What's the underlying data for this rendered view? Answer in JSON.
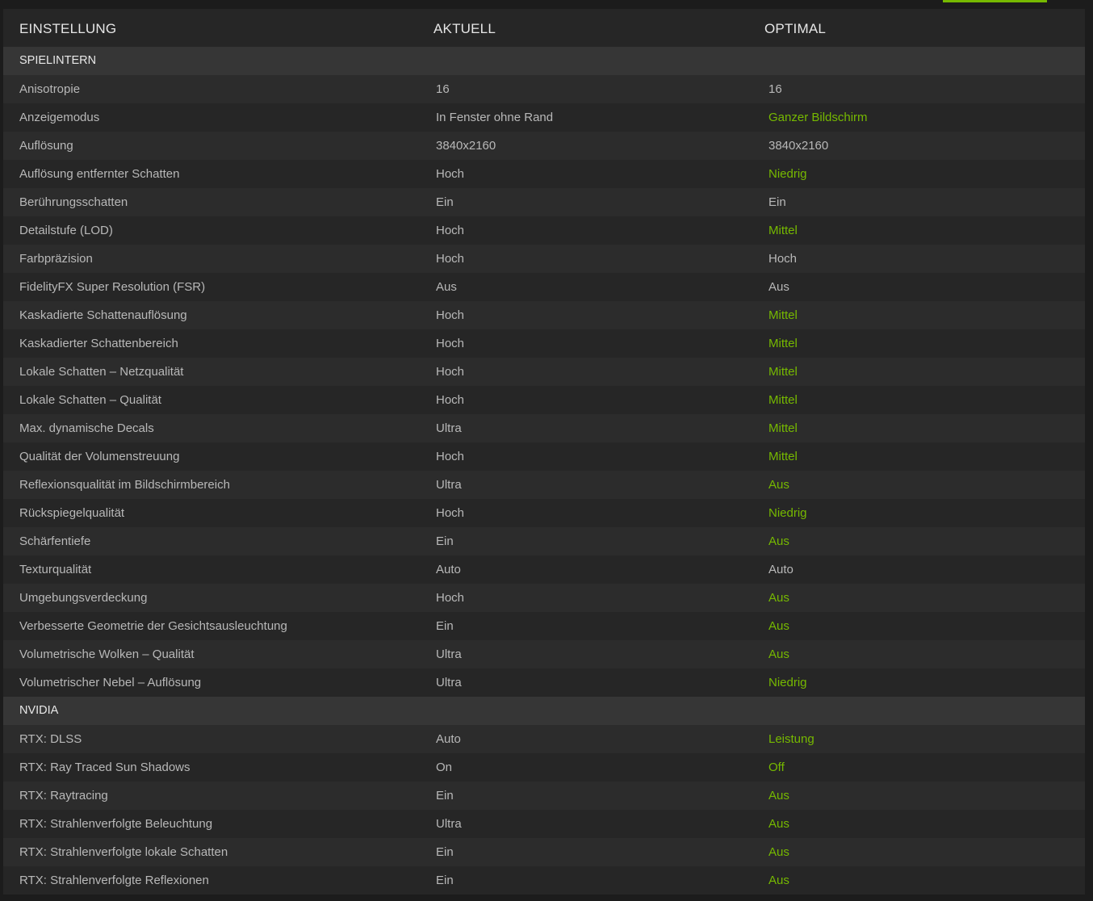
{
  "colors": {
    "accent": "#76b900",
    "background": "#1c1c1c",
    "row_odd": "#2c2c2c",
    "row_even": "#262626",
    "section": "#363636"
  },
  "header": {
    "setting": "EINSTELLUNG",
    "current": "AKTUELL",
    "optimal": "OPTIMAL"
  },
  "sections": [
    {
      "title": "SPIELINTERN",
      "rows": [
        {
          "setting": "Anisotropie",
          "current": "16",
          "optimal": "16",
          "changed": false
        },
        {
          "setting": "Anzeigemodus",
          "current": "In Fenster ohne Rand",
          "optimal": "Ganzer Bildschirm",
          "changed": true
        },
        {
          "setting": "Auflösung",
          "current": "3840x2160",
          "optimal": "3840x2160",
          "changed": false
        },
        {
          "setting": "Auflösung entfernter Schatten",
          "current": "Hoch",
          "optimal": "Niedrig",
          "changed": true
        },
        {
          "setting": "Berührungsschatten",
          "current": "Ein",
          "optimal": "Ein",
          "changed": false
        },
        {
          "setting": "Detailstufe (LOD)",
          "current": "Hoch",
          "optimal": "Mittel",
          "changed": true
        },
        {
          "setting": "Farbpräzision",
          "current": "Hoch",
          "optimal": "Hoch",
          "changed": false
        },
        {
          "setting": "FidelityFX Super Resolution (FSR)",
          "current": "Aus",
          "optimal": "Aus",
          "changed": false
        },
        {
          "setting": "Kaskadierte Schattenauflösung",
          "current": "Hoch",
          "optimal": "Mittel",
          "changed": true
        },
        {
          "setting": "Kaskadierter Schattenbereich",
          "current": "Hoch",
          "optimal": "Mittel",
          "changed": true
        },
        {
          "setting": "Lokale Schatten – Netzqualität",
          "current": "Hoch",
          "optimal": "Mittel",
          "changed": true
        },
        {
          "setting": "Lokale Schatten – Qualität",
          "current": "Hoch",
          "optimal": "Mittel",
          "changed": true
        },
        {
          "setting": "Max. dynamische Decals",
          "current": "Ultra",
          "optimal": "Mittel",
          "changed": true
        },
        {
          "setting": "Qualität der Volumenstreuung",
          "current": "Hoch",
          "optimal": "Mittel",
          "changed": true
        },
        {
          "setting": "Reflexionsqualität im Bildschirmbereich",
          "current": "Ultra",
          "optimal": "Aus",
          "changed": true
        },
        {
          "setting": "Rückspiegelqualität",
          "current": "Hoch",
          "optimal": "Niedrig",
          "changed": true
        },
        {
          "setting": "Schärfentiefe",
          "current": "Ein",
          "optimal": "Aus",
          "changed": true
        },
        {
          "setting": "Texturqualität",
          "current": "Auto",
          "optimal": "Auto",
          "changed": false
        },
        {
          "setting": "Umgebungsverdeckung",
          "current": "Hoch",
          "optimal": "Aus",
          "changed": true
        },
        {
          "setting": "Verbesserte Geometrie der Gesichtsausleuchtung",
          "current": "Ein",
          "optimal": "Aus",
          "changed": true
        },
        {
          "setting": "Volumetrische Wolken – Qualität",
          "current": "Ultra",
          "optimal": "Aus",
          "changed": true
        },
        {
          "setting": "Volumetrischer Nebel – Auflösung",
          "current": "Ultra",
          "optimal": "Niedrig",
          "changed": true
        }
      ]
    },
    {
      "title": "NVIDIA",
      "rows": [
        {
          "setting": "RTX: DLSS",
          "current": "Auto",
          "optimal": "Leistung",
          "changed": true
        },
        {
          "setting": "RTX: Ray Traced Sun Shadows",
          "current": "On",
          "optimal": "Off",
          "changed": true
        },
        {
          "setting": "RTX: Raytracing",
          "current": "Ein",
          "optimal": "Aus",
          "changed": true
        },
        {
          "setting": "RTX: Strahlenverfolgte Beleuchtung",
          "current": "Ultra",
          "optimal": "Aus",
          "changed": true
        },
        {
          "setting": "RTX: Strahlenverfolgte lokale Schatten",
          "current": "Ein",
          "optimal": "Aus",
          "changed": true
        },
        {
          "setting": "RTX: Strahlenverfolgte Reflexionen",
          "current": "Ein",
          "optimal": "Aus",
          "changed": true
        }
      ]
    }
  ]
}
